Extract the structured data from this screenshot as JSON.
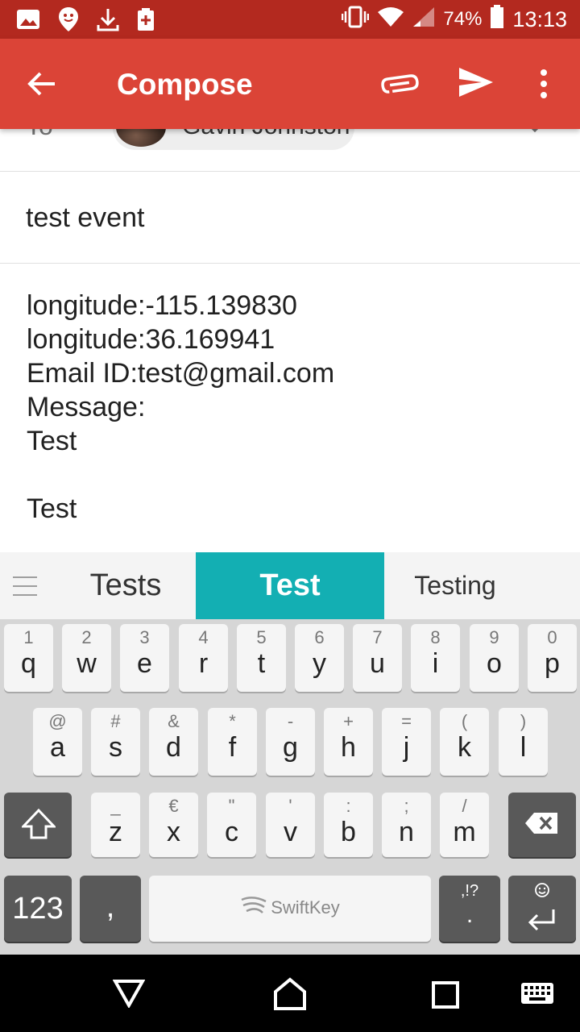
{
  "status_bar": {
    "battery": "74%",
    "time": "13:13"
  },
  "app_bar": {
    "title": "Compose"
  },
  "to_row": {
    "label": "To",
    "recipient": "Gavin Johnston"
  },
  "subject": "test event",
  "body_lines": [
    "longitude:-115.139830",
    "longitude:36.169941",
    "Email ID:test@gmail.com",
    "Message:",
    "Test",
    "",
    "Test"
  ],
  "suggestions": [
    "Tests",
    "Test",
    "Testing"
  ],
  "keyboard": {
    "row1": [
      {
        "p": "q",
        "s": "1"
      },
      {
        "p": "w",
        "s": "2"
      },
      {
        "p": "e",
        "s": "3"
      },
      {
        "p": "r",
        "s": "4"
      },
      {
        "p": "t",
        "s": "5"
      },
      {
        "p": "y",
        "s": "6"
      },
      {
        "p": "u",
        "s": "7"
      },
      {
        "p": "i",
        "s": "8"
      },
      {
        "p": "o",
        "s": "9"
      },
      {
        "p": "p",
        "s": "0"
      }
    ],
    "row2": [
      {
        "p": "a",
        "s": "@"
      },
      {
        "p": "s",
        "s": "#"
      },
      {
        "p": "d",
        "s": "&"
      },
      {
        "p": "f",
        "s": "*"
      },
      {
        "p": "g",
        "s": "-"
      },
      {
        "p": "h",
        "s": "+"
      },
      {
        "p": "j",
        "s": "="
      },
      {
        "p": "k",
        "s": "("
      },
      {
        "p": "l",
        "s": ")"
      }
    ],
    "row3": [
      {
        "p": "z",
        "s": "_"
      },
      {
        "p": "x",
        "s": "€"
      },
      {
        "p": "c",
        "s": "\""
      },
      {
        "p": "v",
        "s": "'"
      },
      {
        "p": "b",
        "s": ":"
      },
      {
        "p": "n",
        "s": ";"
      },
      {
        "p": "m",
        "s": "/"
      }
    ],
    "numbers_key": "123",
    "comma_key": ",",
    "space_label": "SwiftKey",
    "punct_key_top": ",!?",
    "punct_key_main": "."
  },
  "colors": {
    "status_bar": "#b3291f",
    "app_bar": "#db4437",
    "suggestion_highlight": "#13afb3",
    "keyboard_bg": "#d6d6d6"
  },
  "icons": {
    "status_left": [
      "image-icon",
      "location-pin-icon",
      "download-icon",
      "first-aid-icon"
    ],
    "status_right": [
      "vibrate-icon",
      "wifi-icon",
      "signal-icon",
      "battery-icon"
    ],
    "app_bar": [
      "back-arrow-icon",
      "attach-icon",
      "send-icon",
      "more-vert-icon"
    ],
    "nav": [
      "back-triangle-icon",
      "home-icon",
      "recents-icon",
      "keyboard-icon"
    ]
  }
}
